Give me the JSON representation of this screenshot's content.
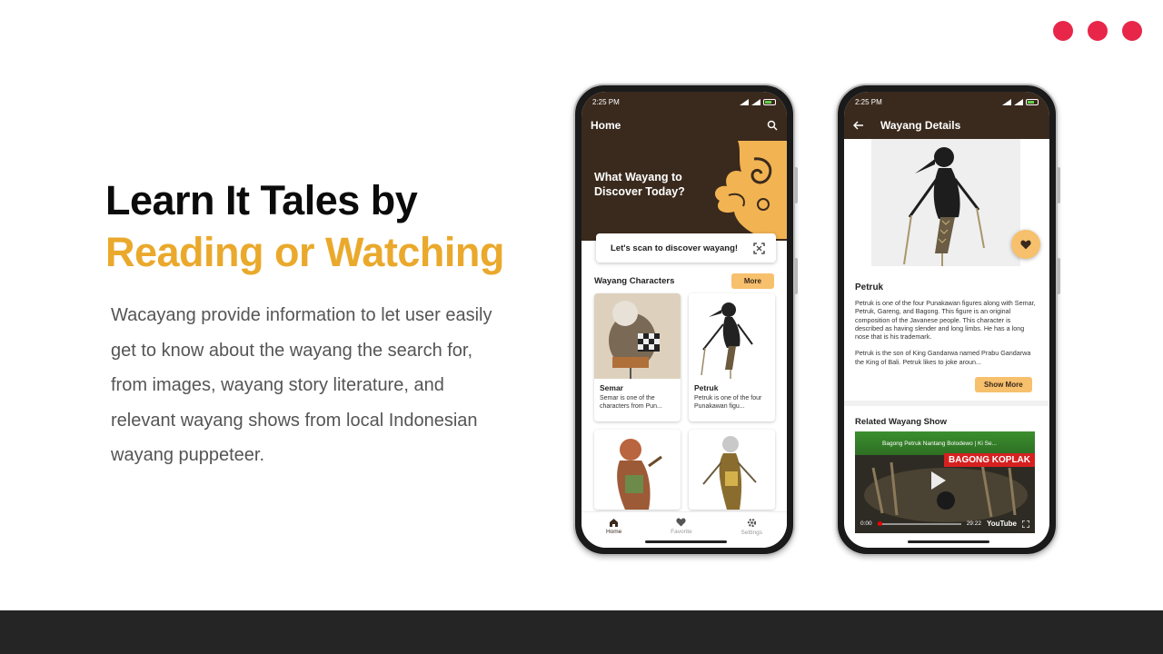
{
  "colors": {
    "accent": "#eaa92c",
    "brand_dark": "#3a2a1d",
    "dots": "#e8264a",
    "button": "#f7c06c",
    "footer": "#252525"
  },
  "slide": {
    "heading_line1": "Learn It Tales by",
    "heading_line2": "Reading or Watching",
    "description": "Wacayang provide information to let user easily get to know about the wayang the search for, from images, wayang story literature, and relevant wayang shows from local Indonesian wayang puppeteer."
  },
  "phone_home": {
    "status_time": "2:25 PM",
    "title": "Home",
    "search_icon": "search-icon",
    "hero_question": "What Wayang to Discover Today?",
    "scan_label": "Let's scan to discover wayang!",
    "section_title": "Wayang Characters",
    "more_label": "More",
    "characters": [
      {
        "name": "Semar",
        "snippet": "Semar is one of the characters from Pun..."
      },
      {
        "name": "Petruk",
        "snippet": "Petruk is one of the four Punakawan figu..."
      }
    ],
    "nav": [
      {
        "label": "Home",
        "icon": "home-icon"
      },
      {
        "label": "Favorite",
        "icon": "heart-icon"
      },
      {
        "label": "Settings",
        "icon": "gear-icon"
      }
    ]
  },
  "phone_detail": {
    "status_time": "2:25 PM",
    "title": "Wayang Details",
    "name": "Petruk",
    "para1": "Petruk is one of the four Punakawan figures along with Semar, Petruk, Gareng, and Bagong. This figure is an original composition of the Javanese people. This character is described as having slender and long limbs. He has a long nose that is his trademark.",
    "para2": "Petruk is the son of King Gandarwa named Prabu Gandarwa the King of Bali. Petruk likes to joke aroun...",
    "show_more_label": "Show More",
    "related_title": "Related Wayang Show",
    "video": {
      "title": "Bagong Petruk Nantang Bolodewo | Ki Se...",
      "tag": "BAGONG KOPLAK",
      "time_current": "0:00",
      "time_total": "29:22",
      "platform": "YouTube"
    }
  }
}
